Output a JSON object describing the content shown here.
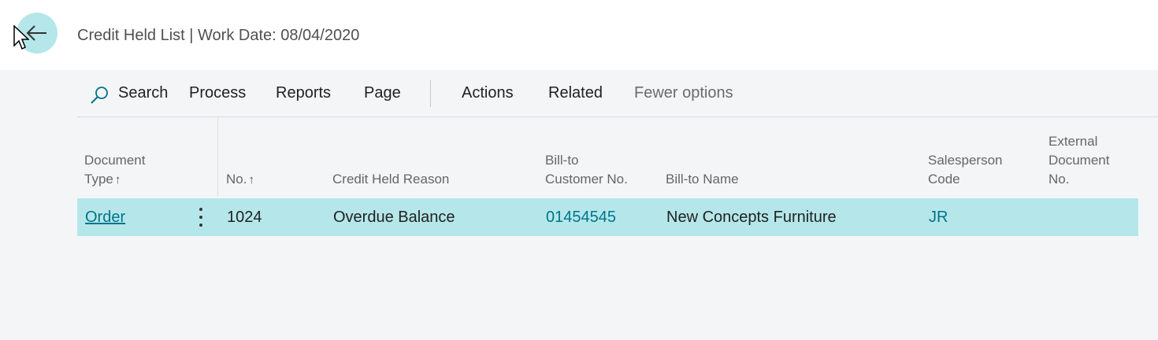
{
  "header": {
    "title": "Credit Held List | Work Date: 08/04/2020",
    "back_icon": "arrow-left-icon"
  },
  "actions": {
    "search": "Search",
    "process": "Process",
    "reports": "Reports",
    "page": "Page",
    "actions": "Actions",
    "related": "Related",
    "fewer_options": "Fewer options"
  },
  "table": {
    "headers": {
      "document_type": [
        "Document",
        "Type"
      ],
      "no": "No.",
      "credit_held_reason": "Credit Held Reason",
      "bill_to_customer_no": [
        "Bill-to",
        "Customer No."
      ],
      "bill_to_name": "Bill-to Name",
      "salesperson_code": [
        "Salesperson",
        "Code"
      ],
      "external_document_no": [
        "External",
        "Document",
        "No."
      ]
    },
    "sort_arrow": "↑",
    "rows": [
      {
        "document_type": "Order",
        "no": "1024",
        "credit_held_reason": "Overdue Balance",
        "bill_to_customer_no": "01454545",
        "bill_to_name": "New Concepts Furniture",
        "salesperson_code": "JR",
        "external_document_no": ""
      }
    ]
  },
  "colors": {
    "selected_row": "#b5e7ea",
    "link": "#00748a",
    "background": "#f4f5f7"
  }
}
